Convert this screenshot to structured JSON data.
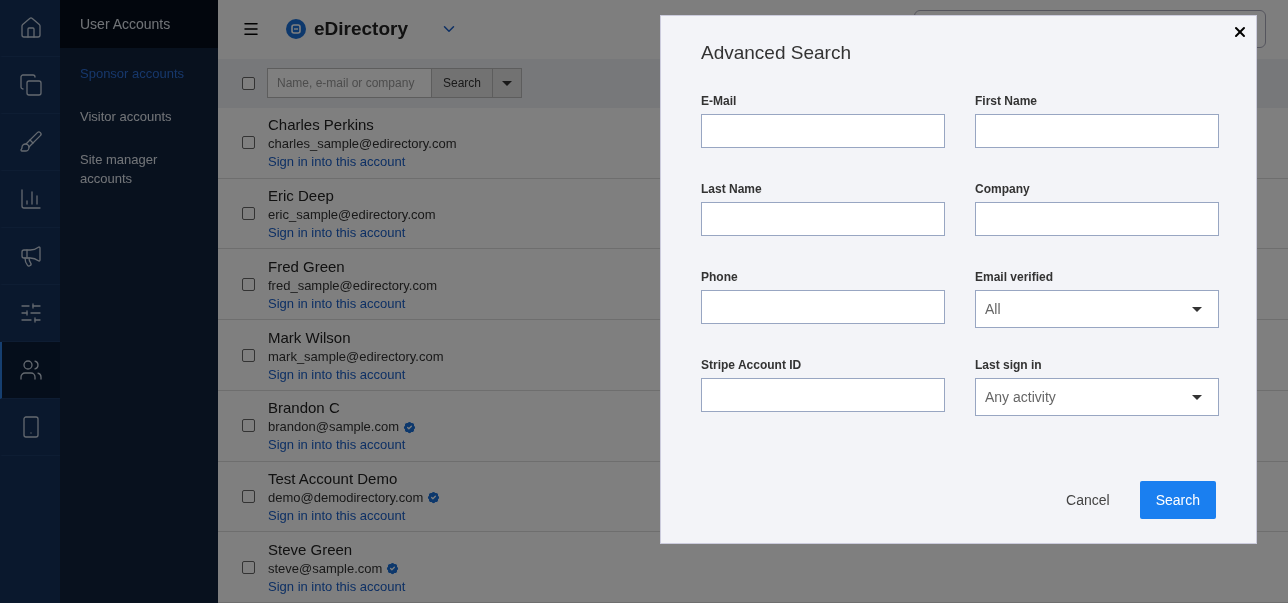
{
  "rail": [
    {
      "selected": false
    },
    {
      "selected": false
    },
    {
      "selected": false
    },
    {
      "selected": false
    },
    {
      "selected": false
    },
    {
      "selected": false
    },
    {
      "selected": true
    },
    {
      "selected": false
    }
  ],
  "sidebar": {
    "title": "User Accounts",
    "items": [
      {
        "label": "Sponsor accounts",
        "selected": true
      },
      {
        "label": "Visitor accounts",
        "selected": false
      },
      {
        "label": "Site manager accounts",
        "selected": false
      }
    ]
  },
  "header": {
    "brand": "eDirectory"
  },
  "toolbar": {
    "select_all_checked": false,
    "placeholder": "Name, e-mail or company",
    "search_button": "Search"
  },
  "accounts": [
    {
      "name": "Charles Perkins",
      "email": "charles_sample@edirectory.com",
      "verified": false,
      "link": "Sign in into this account",
      "checked": false
    },
    {
      "name": "Eric Deep",
      "email": "eric_sample@edirectory.com",
      "verified": false,
      "link": "Sign in into this account",
      "checked": false
    },
    {
      "name": "Fred Green",
      "email": "fred_sample@edirectory.com",
      "verified": false,
      "link": "Sign in into this account",
      "checked": false
    },
    {
      "name": "Mark Wilson",
      "email": "mark_sample@edirectory.com",
      "verified": false,
      "link": "Sign in into this account",
      "checked": false
    },
    {
      "name": "Brandon C",
      "email": "brandon@sample.com",
      "verified": true,
      "link": "Sign in into this account",
      "checked": false
    },
    {
      "name": "Test Account Demo",
      "email": "demo@demodirectory.com",
      "verified": true,
      "link": "Sign in into this account",
      "checked": false
    },
    {
      "name": "Steve Green",
      "email": "steve@sample.com",
      "verified": true,
      "link": "Sign in into this account",
      "checked": false
    }
  ],
  "dialog": {
    "title": "Advanced Search",
    "fields": [
      {
        "label": "E-Mail",
        "kind": "text"
      },
      {
        "label": "First Name",
        "kind": "text"
      },
      {
        "label": "Last Name",
        "kind": "text"
      },
      {
        "label": "Company",
        "kind": "text"
      },
      {
        "label": "Phone",
        "kind": "text"
      },
      {
        "label": "Email verified",
        "kind": "select",
        "value": "All"
      },
      {
        "label": "Stripe Account ID",
        "kind": "text"
      },
      {
        "label": "Last sign in",
        "kind": "select",
        "value": "Any activity"
      }
    ],
    "cancel": "Cancel",
    "submit": "Search"
  }
}
